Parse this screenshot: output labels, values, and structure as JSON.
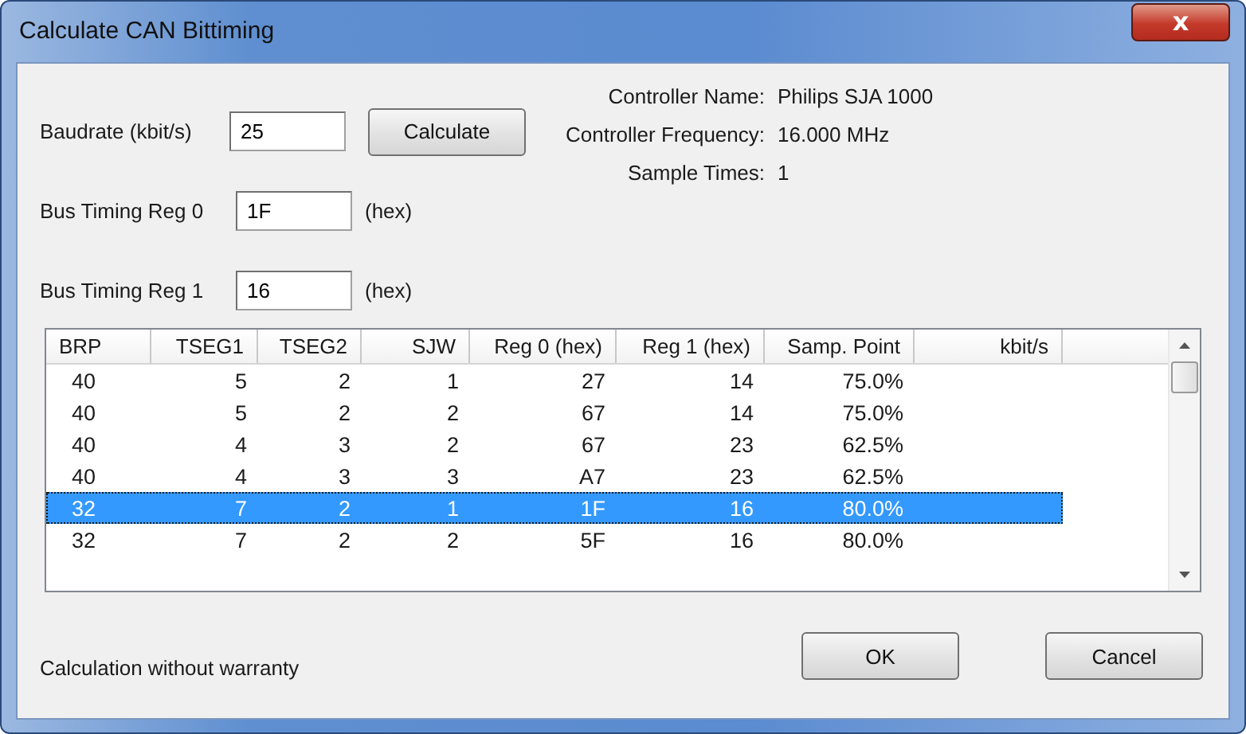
{
  "window": {
    "title": "Calculate CAN Bittiming",
    "close_glyph": "x"
  },
  "fields": [
    {
      "label": "Baudrate (kbit/s)",
      "value": "25",
      "button": "Calculate"
    },
    {
      "label": "Bus Timing Reg 0",
      "value": "1F",
      "unit": "(hex)"
    },
    {
      "label": "Bus Timing Reg 1",
      "value": "16",
      "unit": "(hex)"
    }
  ],
  "info": [
    {
      "label": "Controller Name:",
      "value": "Philips SJA 1000"
    },
    {
      "label": "Controller Frequency:",
      "value": "16.000 MHz"
    },
    {
      "label": "Sample Times:",
      "value": "1"
    }
  ],
  "table": {
    "columns": [
      "BRP",
      "TSEG1",
      "TSEG2",
      "SJW",
      "Reg 0 (hex)",
      "Reg 1 (hex)",
      "Samp. Point",
      "kbit/s"
    ],
    "rows": [
      {
        "cells": [
          "40",
          "5",
          "2",
          "1",
          "27",
          "14",
          "75.0%"
        ],
        "selected": false
      },
      {
        "cells": [
          "40",
          "5",
          "2",
          "2",
          "67",
          "14",
          "75.0%"
        ],
        "selected": false
      },
      {
        "cells": [
          "40",
          "4",
          "3",
          "2",
          "67",
          "23",
          "62.5%"
        ],
        "selected": false
      },
      {
        "cells": [
          "40",
          "4",
          "3",
          "3",
          "A7",
          "23",
          "62.5%"
        ],
        "selected": false
      },
      {
        "cells": [
          "32",
          "7",
          "2",
          "1",
          "1F",
          "16",
          "80.0%"
        ],
        "selected": true
      },
      {
        "cells": [
          "32",
          "7",
          "2",
          "2",
          "5F",
          "16",
          "80.0%"
        ],
        "selected": false
      }
    ]
  },
  "note": "Calculation without warranty",
  "buttons": [
    "OK",
    "Cancel"
  ]
}
